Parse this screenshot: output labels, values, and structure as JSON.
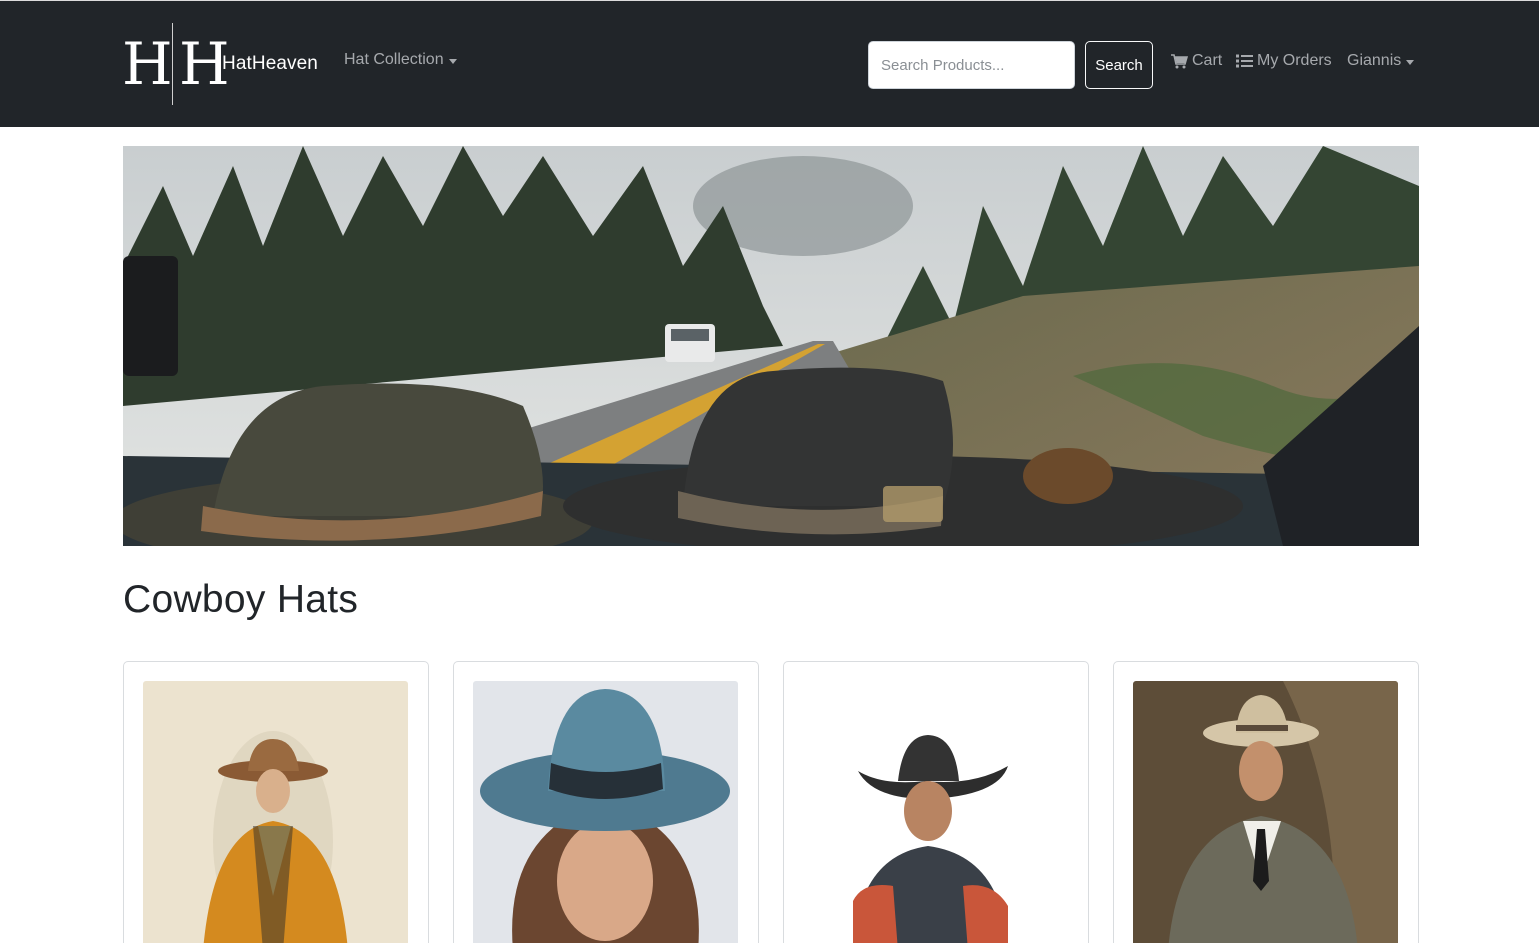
{
  "brand": {
    "logo_letters": "HH",
    "name": "HatHeaven"
  },
  "nav": {
    "collection_label": "Hat Collection",
    "search_placeholder": "Search Products...",
    "search_button": "Search",
    "cart_label": "Cart",
    "orders_label": "My Orders",
    "user_label": "Giannis",
    "icons": [
      "cart-icon",
      "list-icon",
      "caret-down-icon"
    ]
  },
  "section": {
    "title": "Cowboy Hats"
  },
  "colors": {
    "navbar_bg": "#212529",
    "nav_text": "#a6a9ad",
    "brand_text": "#ffffff",
    "page_bg": "#ffffff"
  }
}
